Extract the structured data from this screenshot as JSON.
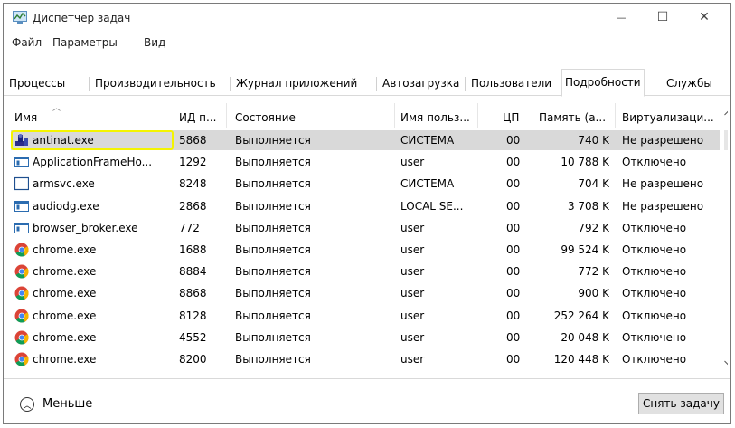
{
  "window": {
    "title": "Диспетчер задач",
    "controls": {
      "minimize": "—",
      "maximize": "☐",
      "close": "✕"
    }
  },
  "menu": [
    "Файл",
    "Параметры",
    "Вид"
  ],
  "tabs": [
    {
      "label": "Процессы",
      "active": false
    },
    {
      "label": "Производительность",
      "active": false
    },
    {
      "label": "Журнал приложений",
      "active": false
    },
    {
      "label": "Автозагрузка",
      "active": false
    },
    {
      "label": "Пользователи",
      "active": false
    },
    {
      "label": "Подробности",
      "active": true
    },
    {
      "label": "Службы",
      "active": false
    }
  ],
  "table": {
    "columns": [
      "Имя",
      "ИД п...",
      "Состояние",
      "Имя польз...",
      "ЦП",
      "Память (а...",
      "Виртуализаци..."
    ],
    "rows": [
      {
        "icon": "antinat-icon",
        "name": "antinat.exe",
        "pid": "5868",
        "state": "Выполняется",
        "user": "СИСТЕМА",
        "cpu": "00",
        "mem": "740 K",
        "virt": "Не разрешено",
        "selected": true
      },
      {
        "icon": "window-app-icon",
        "name": "ApplicationFrameHo...",
        "pid": "1292",
        "state": "Выполняется",
        "user": "user",
        "cpu": "00",
        "mem": "10 788 K",
        "virt": "Отключено"
      },
      {
        "icon": "blank-window-icon",
        "name": "armsvc.exe",
        "pid": "8248",
        "state": "Выполняется",
        "user": "СИСТЕМА",
        "cpu": "00",
        "mem": "704 K",
        "virt": "Не разрешено"
      },
      {
        "icon": "window-app-icon",
        "name": "audiodg.exe",
        "pid": "2868",
        "state": "Выполняется",
        "user": "LOCAL SE...",
        "cpu": "00",
        "mem": "3 708 K",
        "virt": "Не разрешено"
      },
      {
        "icon": "window-app-icon",
        "name": "browser_broker.exe",
        "pid": "772",
        "state": "Выполняется",
        "user": "user",
        "cpu": "00",
        "mem": "792 K",
        "virt": "Отключено"
      },
      {
        "icon": "chrome-icon",
        "name": "chrome.exe",
        "pid": "1688",
        "state": "Выполняется",
        "user": "user",
        "cpu": "00",
        "mem": "99 524 K",
        "virt": "Отключено"
      },
      {
        "icon": "chrome-icon",
        "name": "chrome.exe",
        "pid": "8884",
        "state": "Выполняется",
        "user": "user",
        "cpu": "00",
        "mem": "772 K",
        "virt": "Отключено"
      },
      {
        "icon": "chrome-icon",
        "name": "chrome.exe",
        "pid": "8868",
        "state": "Выполняется",
        "user": "user",
        "cpu": "00",
        "mem": "900 K",
        "virt": "Отключено"
      },
      {
        "icon": "chrome-icon",
        "name": "chrome.exe",
        "pid": "8128",
        "state": "Выполняется",
        "user": "user",
        "cpu": "00",
        "mem": "252 264 K",
        "virt": "Отключено"
      },
      {
        "icon": "chrome-icon",
        "name": "chrome.exe",
        "pid": "4552",
        "state": "Выполняется",
        "user": "user",
        "cpu": "00",
        "mem": "20 048 K",
        "virt": "Отключено"
      },
      {
        "icon": "chrome-icon",
        "name": "chrome.exe",
        "pid": "8200",
        "state": "Выполняется",
        "user": "user",
        "cpu": "00",
        "mem": "120 448 K",
        "virt": "Отключено"
      }
    ]
  },
  "footer": {
    "less_label": "Меньше",
    "end_task": "Снять задачу"
  },
  "colors": {
    "selected_row": "#d9d9d9",
    "highlight": "#f4f400",
    "border": "#d9d9d9"
  }
}
